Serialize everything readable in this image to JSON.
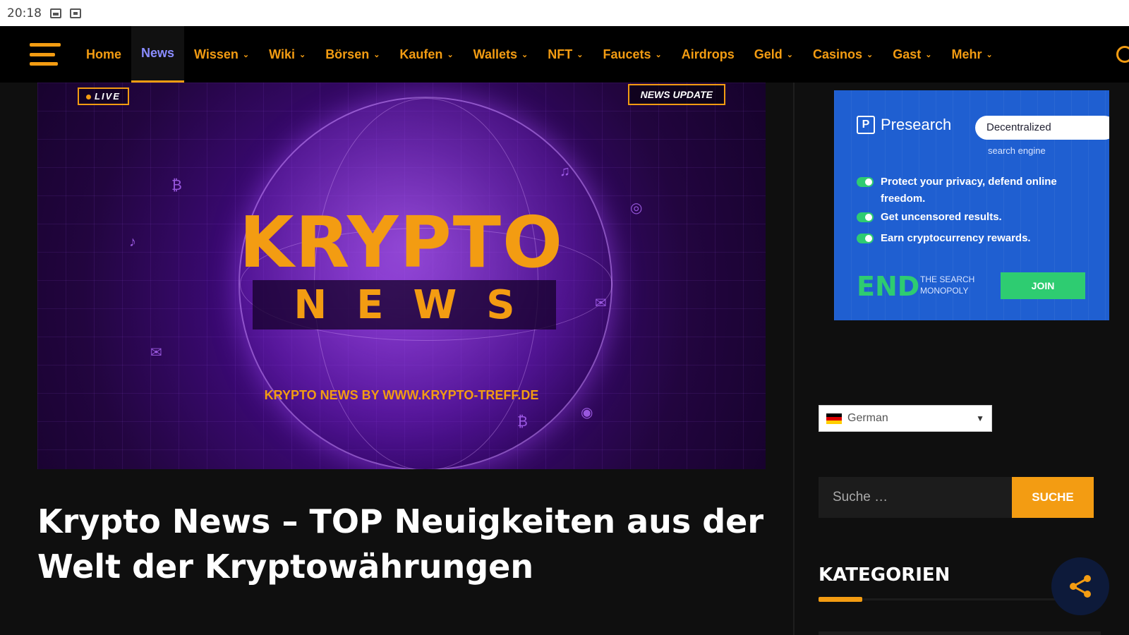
{
  "statusbar": {
    "time": "20:18",
    "icons": [
      "image-icon",
      "box-icon"
    ]
  },
  "nav": {
    "menu": [
      {
        "label": "Home",
        "dropdown": false,
        "active": false
      },
      {
        "label": "News",
        "dropdown": false,
        "active": true
      },
      {
        "label": "Wissen",
        "dropdown": true,
        "active": false
      },
      {
        "label": "Wiki",
        "dropdown": true,
        "active": false
      },
      {
        "label": "Börsen",
        "dropdown": true,
        "active": false
      },
      {
        "label": "Kaufen",
        "dropdown": true,
        "active": false
      },
      {
        "label": "Wallets",
        "dropdown": true,
        "active": false
      },
      {
        "label": "NFT",
        "dropdown": true,
        "active": false
      },
      {
        "label": "Faucets",
        "dropdown": true,
        "active": false
      },
      {
        "label": "Airdrops",
        "dropdown": false,
        "active": false
      },
      {
        "label": "Geld",
        "dropdown": true,
        "active": false
      },
      {
        "label": "Casinos",
        "dropdown": true,
        "active": false
      },
      {
        "label": "Gast",
        "dropdown": true,
        "active": false
      },
      {
        "label": "Mehr",
        "dropdown": true,
        "active": false
      }
    ],
    "accent_color": "#f39c12",
    "active_color": "#8a8cff"
  },
  "hero": {
    "live_badge": "LIVE",
    "update_badge": "NEWS UPDATE",
    "title": "KRYPTO",
    "subtitle": "NEWS",
    "credit": "KRYPTO NEWS BY WWW.KRYPTO-TREFF.DE"
  },
  "article": {
    "headline": "Krypto News – TOP Neuigkeiten aus der Welt der Kryptowährungen"
  },
  "ad": {
    "brand": "Presearch",
    "search_value": "Decentralized",
    "search_note": "search engine",
    "features": [
      "Protect your privacy, defend online freedom.",
      "Get uncensored results.",
      "Earn cryptocurrency rewards."
    ],
    "end_word": "END",
    "end_sub": "THE SEARCH MONOPOLY",
    "join_label": "JOIN"
  },
  "sidebar": {
    "language": "German",
    "search_placeholder": "Suche …",
    "search_button": "SUCHE",
    "categories_title": "KATEGORIEN"
  }
}
